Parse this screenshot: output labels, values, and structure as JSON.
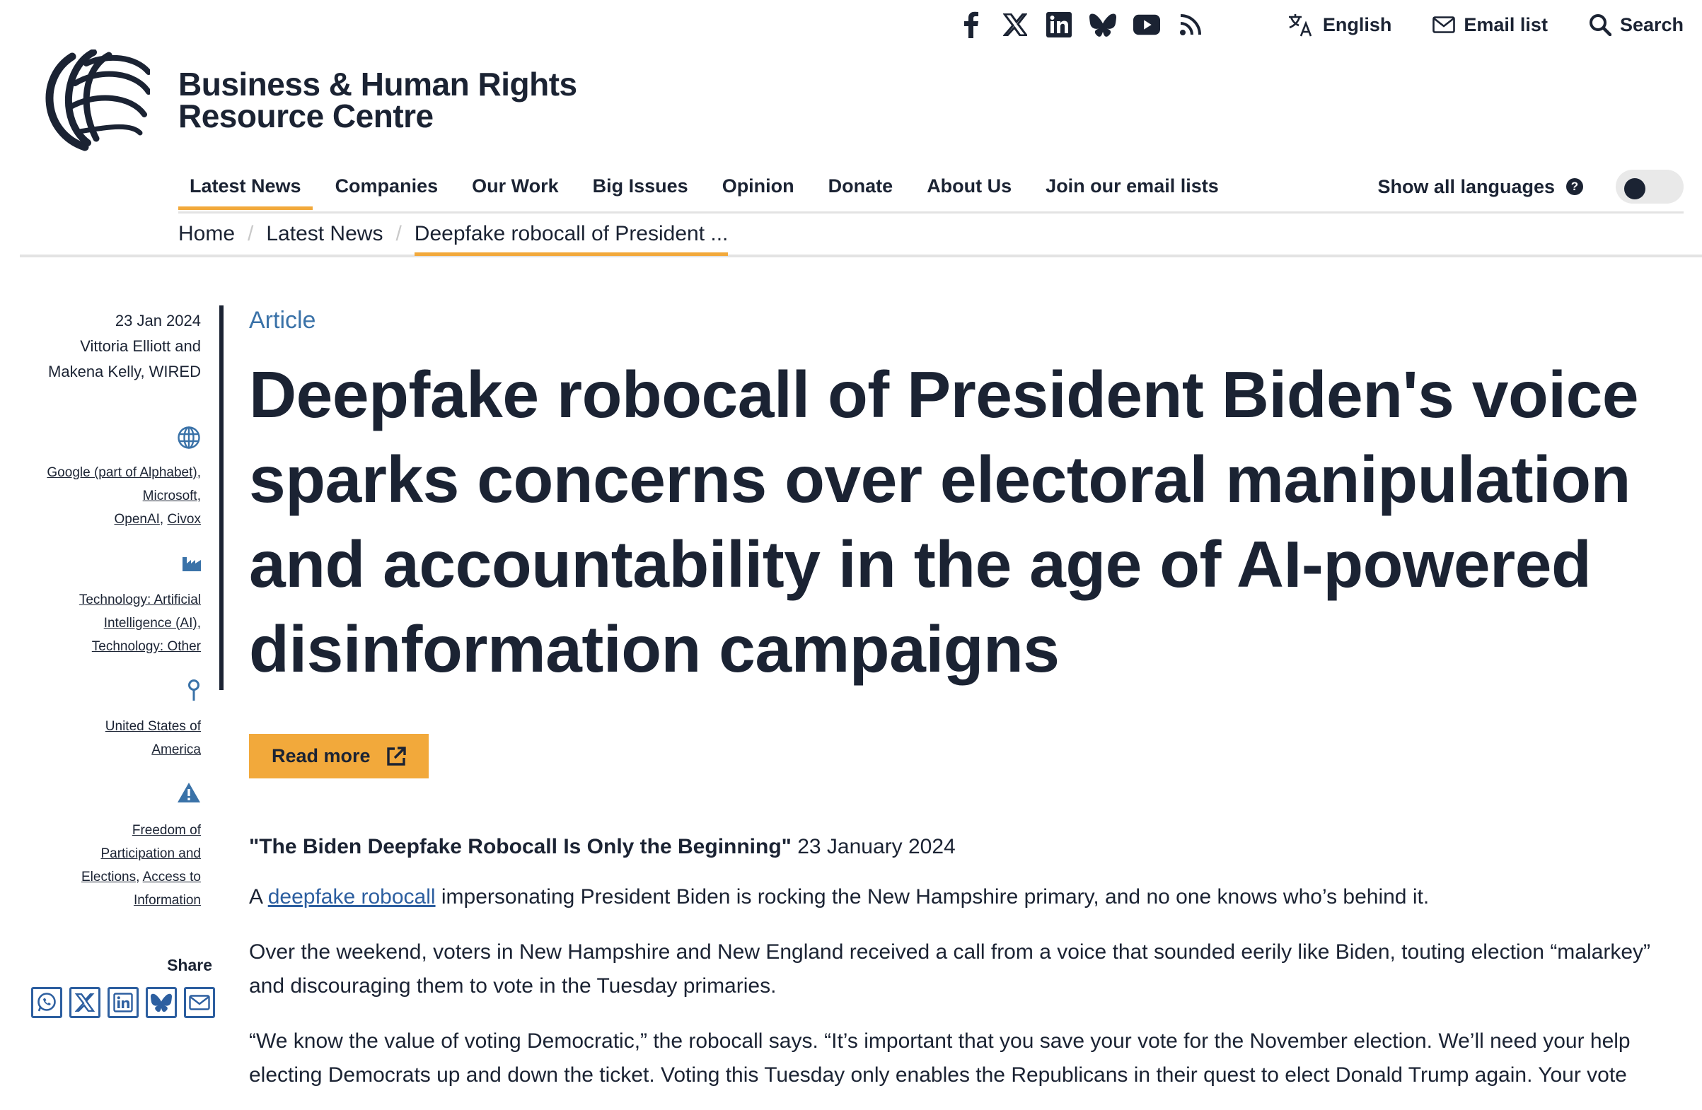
{
  "site": {
    "name_line1": "Business & Human Rights",
    "name_line2": "Resource Centre"
  },
  "topbar": {
    "social_icons": [
      "facebook-icon",
      "x-icon",
      "linkedin-icon",
      "bluesky-icon",
      "youtube-icon",
      "rss-icon"
    ],
    "language_label": "English",
    "email_label": "Email list",
    "search_label": "Search"
  },
  "nav": {
    "items": [
      "Latest News",
      "Companies",
      "Our Work",
      "Big Issues",
      "Opinion",
      "Donate",
      "About Us",
      "Join our email lists"
    ],
    "active": "Latest News",
    "languages_label": "Show all languages",
    "help_glyph": "?"
  },
  "breadcrumb": {
    "home": "Home",
    "section": "Latest News",
    "current": "Deepfake robocall of President ..."
  },
  "meta": {
    "date": "23 Jan 2024",
    "author_line1": "Vittoria Elliott and",
    "author_line2": "Makena Kelly, WIRED",
    "companies": [
      "Google (part of Alphabet)",
      "Microsoft",
      "OpenAI",
      "Civox"
    ],
    "sectors": [
      "Technology: Artificial Intelligence (AI)",
      "Technology: Other"
    ],
    "locations": [
      "United States of America"
    ],
    "issues": [
      "Freedom of Participation and Elections",
      "Access to Information"
    ],
    "share_label": "Share",
    "share_icons": [
      "whatsapp-icon",
      "x-icon",
      "linkedin-icon",
      "bluesky-icon",
      "email-icon"
    ]
  },
  "article": {
    "kicker": "Article",
    "headline": "Deepfake robocall of President Biden's voice sparks concerns over electoral manipulation and accountability in the age of AI-powered disinformation campaigns",
    "read_more": "Read more",
    "source_title": "\"The Biden Deepfake Robocall Is Only the Beginning\"",
    "source_date": " 23 January 2024",
    "p1_prefix": "A ",
    "p1_link": "deepfake robocall",
    "p1_suffix": " impersonating President Biden is rocking the New Hampshire primary, and no one knows who’s behind it.",
    "p2": "Over the weekend, voters in New Hampshire and New England received a call from a voice that sounded eerily like Biden, touting election “malarkey” and discouraging them to vote in the Tuesday primaries.",
    "p3": "“We know the value of voting Democratic,” the robocall says. “It’s important that you save your vote for the November election. We’ll need your help electing Democrats up and down the ticket. Voting this Tuesday only enables the Republicans in their quest to elect Donald Trump again. Your vote"
  }
}
